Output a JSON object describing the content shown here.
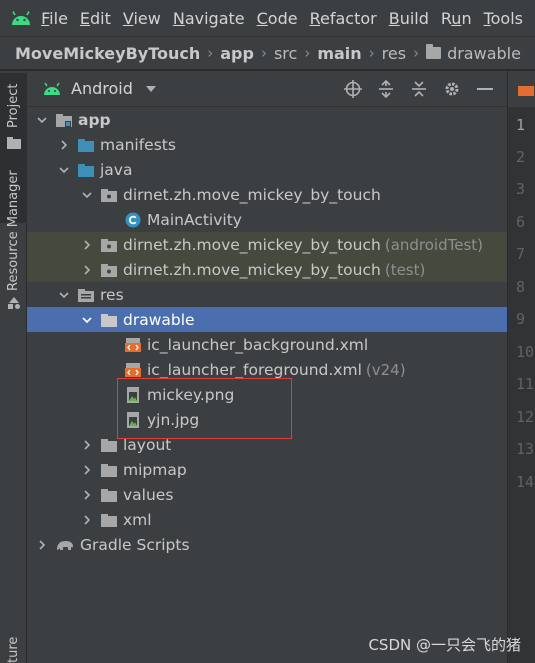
{
  "menu": {
    "items": [
      {
        "label": "File",
        "u": "F"
      },
      {
        "label": "Edit",
        "u": "E"
      },
      {
        "label": "View",
        "u": "V"
      },
      {
        "label": "Navigate",
        "u": "N"
      },
      {
        "label": "Code",
        "u": "C"
      },
      {
        "label": "Refactor",
        "u": "R"
      },
      {
        "label": "Build",
        "u": "B"
      },
      {
        "label": "Run",
        "u": "u"
      },
      {
        "label": "Tools",
        "u": "T"
      }
    ]
  },
  "breadcrumb": {
    "project": "MoveMickeyByTouch",
    "module": "app",
    "src": "src",
    "main": "main",
    "res": "res",
    "drawable": "drawable"
  },
  "tool_strip": {
    "project": "Project",
    "resource_manager": "Resource Manager",
    "structure_partial": "ture"
  },
  "panel": {
    "view_selector": "Android"
  },
  "tree": {
    "app": "app",
    "manifests": "manifests",
    "java": "java",
    "pkg_main": "dirnet.zh.move_mickey_by_touch",
    "main_activity": "MainActivity",
    "pkg_android_test": "dirnet.zh.move_mickey_by_touch",
    "android_test_suffix": "(androidTest)",
    "pkg_test": "dirnet.zh.move_mickey_by_touch",
    "test_suffix": "(test)",
    "res": "res",
    "drawable": "drawable",
    "ic_bg": "ic_launcher_background.xml",
    "ic_fg": "ic_launcher_foreground.xml",
    "ic_fg_suffix": "(v24)",
    "mickey": "mickey.png",
    "yjn": "yjn.jpg",
    "layout": "layout",
    "mipmap": "mipmap",
    "values": "values",
    "xml": "xml",
    "gradle_scripts": "Gradle Scripts"
  },
  "gutter": {
    "lines": [
      "1",
      "2",
      "3",
      "6",
      "7",
      "8",
      "9",
      "10",
      "11",
      "12",
      "13",
      "14"
    ]
  },
  "watermark": "CSDN @一只会飞的猪",
  "colors": {
    "selection": "#4b6eaf",
    "test_row": "#45493e",
    "highlight_box": "#e03c3c",
    "android_green": "#3ddc84"
  }
}
